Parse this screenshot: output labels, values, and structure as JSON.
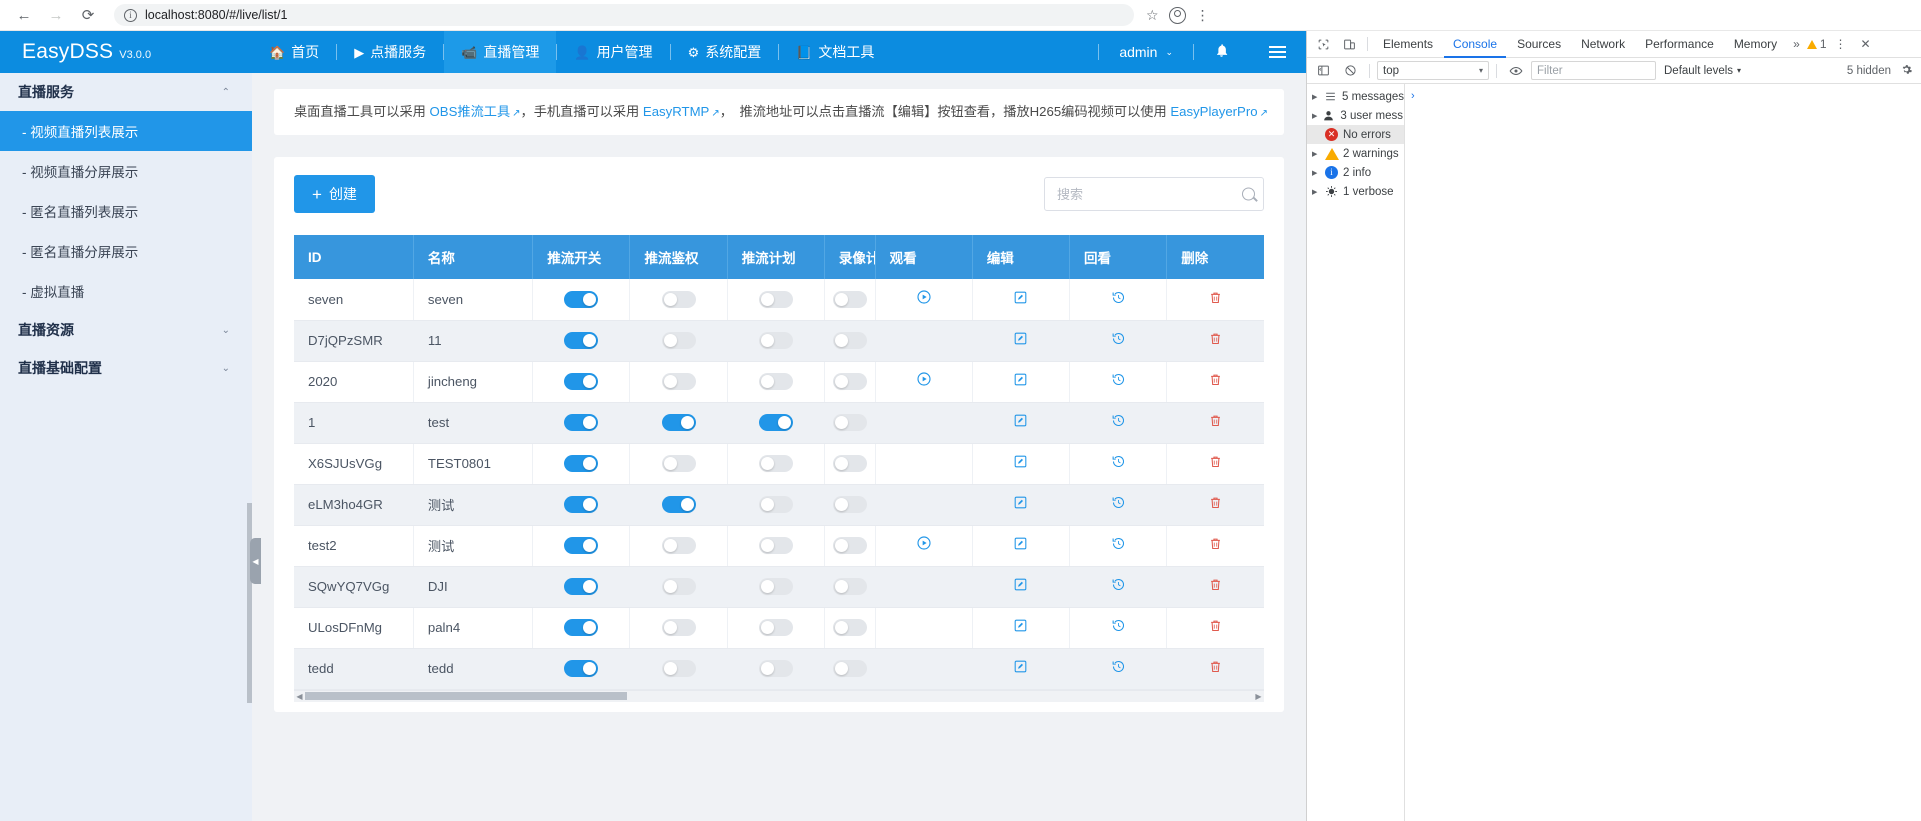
{
  "browser": {
    "back_icon": "←",
    "forward_icon": "→",
    "reload_icon": "⟳",
    "url": "localhost:8080/#/live/list/1",
    "info_icon": "i",
    "star_icon": "☆",
    "profile_icon": "account-circle",
    "menu_icon": "⋮"
  },
  "appnav": {
    "brand": "EasyDSS",
    "version": "V3.0.0",
    "items": [
      {
        "label": "首页",
        "icon": "🏠",
        "active": false
      },
      {
        "label": "点播服务",
        "icon": "▶",
        "active": false
      },
      {
        "label": "直播管理",
        "icon": "📹",
        "active": true
      },
      {
        "label": "用户管理",
        "icon": "👤",
        "active": false
      },
      {
        "label": "系统配置",
        "icon": "⚙",
        "active": false
      },
      {
        "label": "文档工具",
        "icon": "📘",
        "active": false
      }
    ],
    "user": "admin",
    "user_caret": "⌄",
    "bell_icon": "🔔",
    "menu_icon": "hamburger"
  },
  "sidebar": {
    "groups": [
      {
        "label": "直播服务",
        "chevron": "⌃"
      },
      {
        "label": "直播资源",
        "chevron": "⌄"
      },
      {
        "label": "直播基础配置",
        "chevron": "⌄"
      }
    ],
    "items": [
      {
        "label": "- 视频直播列表展示",
        "active": true
      },
      {
        "label": "- 视频直播分屏展示",
        "active": false
      },
      {
        "label": "- 匿名直播列表展示",
        "active": false
      },
      {
        "label": "- 匿名直播分屏展示",
        "active": false
      },
      {
        "label": "- 虚拟直播",
        "active": false
      }
    ],
    "collapse_handle": "◀"
  },
  "notice": {
    "p1": "桌面直播工具可以采用",
    "link1": "OBS推流工具",
    "p2": "，手机直播可以采用",
    "link2": "EasyRTMP",
    "p3": "，　推流地址可以点击直播流【编辑】按钮查看，播放H265编码视频可以使用",
    "link3": "EasyPlayerPro",
    "ext_icon": "↗"
  },
  "toolbar": {
    "create_label": "创建",
    "create_plus": "+",
    "search_placeholder": "搜索",
    "search_value": "",
    "search_icon": "search-icon"
  },
  "table": {
    "columns": [
      "ID",
      "名称",
      "推流开关",
      "推流鉴权",
      "推流计划",
      "录像计",
      "观看",
      "编辑",
      "回看",
      "删除"
    ],
    "rows": [
      {
        "id": "seven",
        "name": "seven",
        "push": true,
        "auth": false,
        "plan": false,
        "record": false,
        "watch": true,
        "edit": true,
        "review": true,
        "del": true
      },
      {
        "id": "D7jQPzSMR",
        "name": "11",
        "push": true,
        "auth": false,
        "plan": false,
        "record": false,
        "watch": false,
        "edit": true,
        "review": true,
        "del": true
      },
      {
        "id": "2020",
        "name": "jincheng",
        "push": true,
        "auth": false,
        "plan": false,
        "record": false,
        "watch": true,
        "edit": true,
        "review": true,
        "del": true
      },
      {
        "id": "1",
        "name": "test",
        "push": true,
        "auth": true,
        "plan": true,
        "record": false,
        "watch": false,
        "edit": true,
        "review": true,
        "del": true
      },
      {
        "id": "X6SJUsVGg",
        "name": "TEST0801",
        "push": true,
        "auth": false,
        "plan": false,
        "record": false,
        "watch": false,
        "edit": true,
        "review": true,
        "del": true
      },
      {
        "id": "eLM3ho4GR",
        "name": "测试",
        "push": true,
        "auth": true,
        "plan": false,
        "record": false,
        "watch": false,
        "edit": true,
        "review": true,
        "del": true
      },
      {
        "id": "test2",
        "name": "测试",
        "push": true,
        "auth": false,
        "plan": false,
        "record": false,
        "watch": true,
        "edit": true,
        "review": true,
        "del": true
      },
      {
        "id": "SQwYQ7VGg",
        "name": "DJI",
        "push": true,
        "auth": false,
        "plan": false,
        "record": false,
        "watch": false,
        "edit": true,
        "review": true,
        "del": true
      },
      {
        "id": "ULosDFnMg",
        "name": "paln4",
        "push": true,
        "auth": false,
        "plan": false,
        "record": false,
        "watch": false,
        "edit": true,
        "review": true,
        "del": true
      },
      {
        "id": "tedd",
        "name": "tedd",
        "push": true,
        "auth": false,
        "plan": false,
        "record": false,
        "watch": false,
        "edit": true,
        "review": true,
        "del": true
      }
    ],
    "icons": {
      "play": "⊙",
      "edit": "✎",
      "review": "↺",
      "delete": "🗑"
    },
    "scroll_left": "◀",
    "scroll_right": "▶"
  },
  "devtools": {
    "inspect_icon": "cursor-select-icon",
    "device_icon": "device-toggle-icon",
    "tabs": [
      {
        "label": "Elements",
        "active": false
      },
      {
        "label": "Console",
        "active": true
      },
      {
        "label": "Sources",
        "active": false
      },
      {
        "label": "Network",
        "active": false
      },
      {
        "label": "Performance",
        "active": false
      },
      {
        "label": "Memory",
        "active": false
      }
    ],
    "more_tabs": "»",
    "warning_count": "1",
    "kebab": "⋮",
    "close": "✕",
    "sidebar_toggle_icon": "console-sidebar-icon",
    "clear_icon": "🚫",
    "context": "top",
    "context_caret": "▾",
    "eye_icon": "👁",
    "filter_placeholder": "Filter",
    "levels_label": "Default levels",
    "levels_caret": "▾",
    "hidden_label": "5 hidden",
    "settings_icon": "⚙",
    "sidebar_rows": [
      {
        "label": "5 messages",
        "icon": "list",
        "arrow": true,
        "selected": false
      },
      {
        "label": "3 user mess…",
        "icon": "user",
        "arrow": true,
        "selected": false
      },
      {
        "label": "No errors",
        "icon": "error",
        "arrow": false,
        "selected": true
      },
      {
        "label": "2 warnings",
        "icon": "warning",
        "arrow": true,
        "selected": false
      },
      {
        "label": "2 info",
        "icon": "info",
        "arrow": true,
        "selected": false
      },
      {
        "label": "1 verbose",
        "icon": "verbose",
        "arrow": true,
        "selected": false
      }
    ],
    "prompt": "›"
  },
  "colors": {
    "brand_blue": "#0c8ce0",
    "accent": "#2196e8",
    "table_header": "#3796dd",
    "danger": "#e05a4e",
    "sidebar_bg": "#e8eef7"
  }
}
